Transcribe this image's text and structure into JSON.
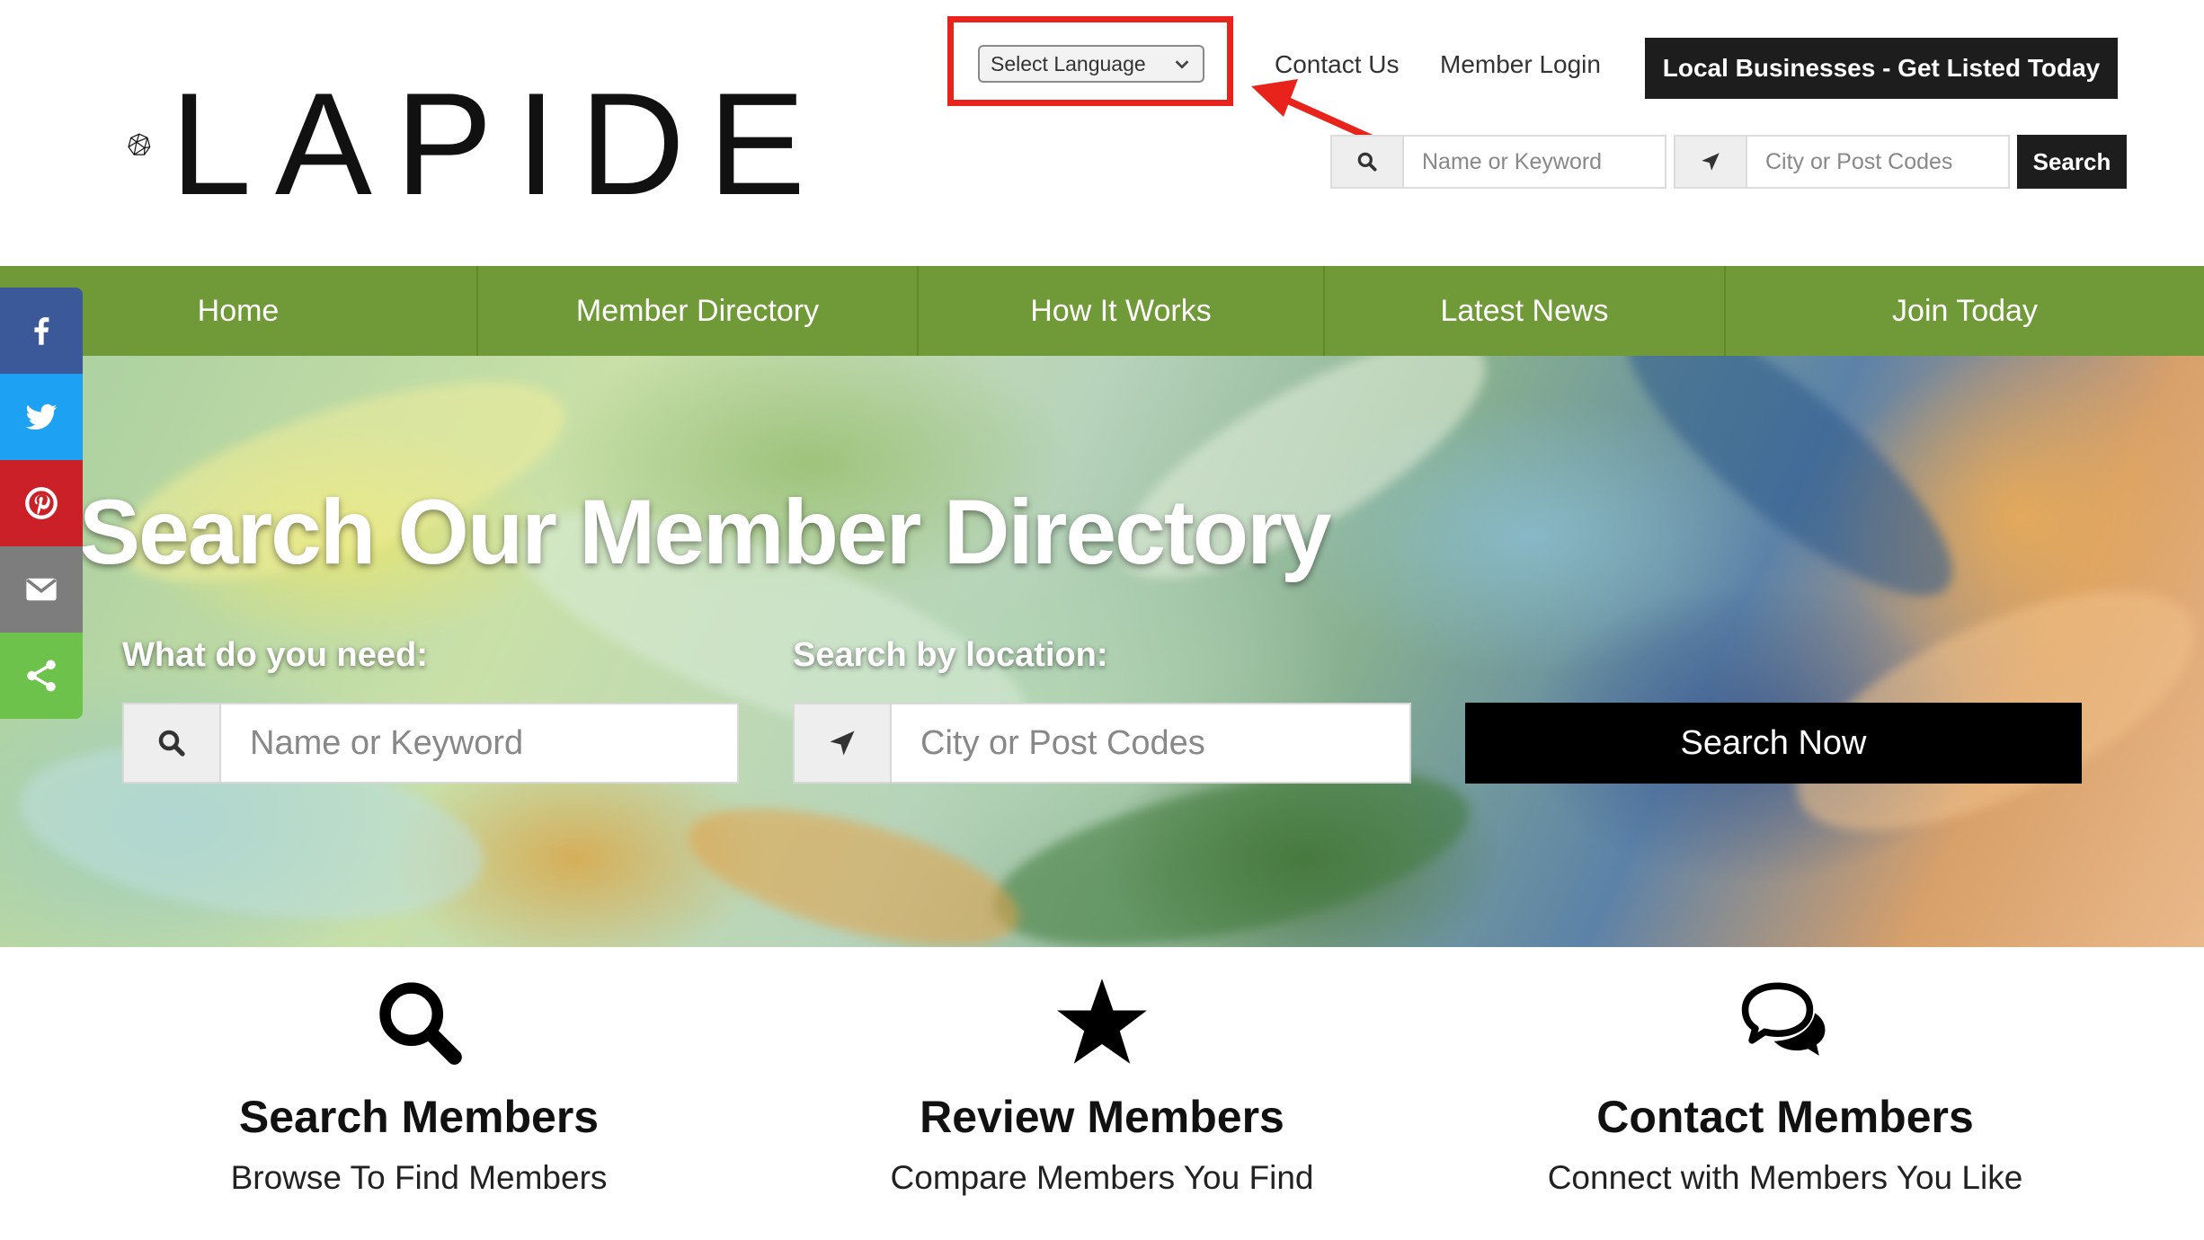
{
  "brand": {
    "name": "LAPIDE"
  },
  "header": {
    "language_select": {
      "value": "Select Language"
    },
    "links": {
      "contact": "Contact Us",
      "login": "Member Login"
    },
    "cta_label": "Local Businesses - Get Listed Today",
    "search": {
      "keyword_placeholder": "Name or Keyword",
      "location_placeholder": "City or Post Codes",
      "button_label": "Search"
    }
  },
  "nav": {
    "items": [
      {
        "label": "Home"
      },
      {
        "label": "Member Directory"
      },
      {
        "label": "How It Works"
      },
      {
        "label": "Latest News"
      },
      {
        "label": "Join Today"
      }
    ],
    "color": "#6f9a37"
  },
  "hero": {
    "title": "Search Our Member Directory",
    "need_label": "What do you need:",
    "location_label": "Search by location:",
    "keyword_placeholder": "Name or Keyword",
    "location_placeholder": "City or Post Codes",
    "button_label": "Search Now"
  },
  "social": [
    {
      "icon": "facebook-icon",
      "color": "#3b5998"
    },
    {
      "icon": "twitter-icon",
      "color": "#1da1f2"
    },
    {
      "icon": "pinterest-icon",
      "color": "#cb2027"
    },
    {
      "icon": "email-icon",
      "color": "#7d7d7d"
    },
    {
      "icon": "share-icon",
      "color": "#6cc24a"
    }
  ],
  "features": [
    {
      "icon": "magnifier-icon",
      "title": "Search Members",
      "subtitle": "Browse To Find Members"
    },
    {
      "icon": "star-icon",
      "title": "Review Members",
      "subtitle": "Compare Members You Find"
    },
    {
      "icon": "chat-bubbles-icon",
      "title": "Contact Members",
      "subtitle": "Connect with Members You Like"
    }
  ],
  "annotation": {
    "highlight_color": "#e8231b"
  }
}
